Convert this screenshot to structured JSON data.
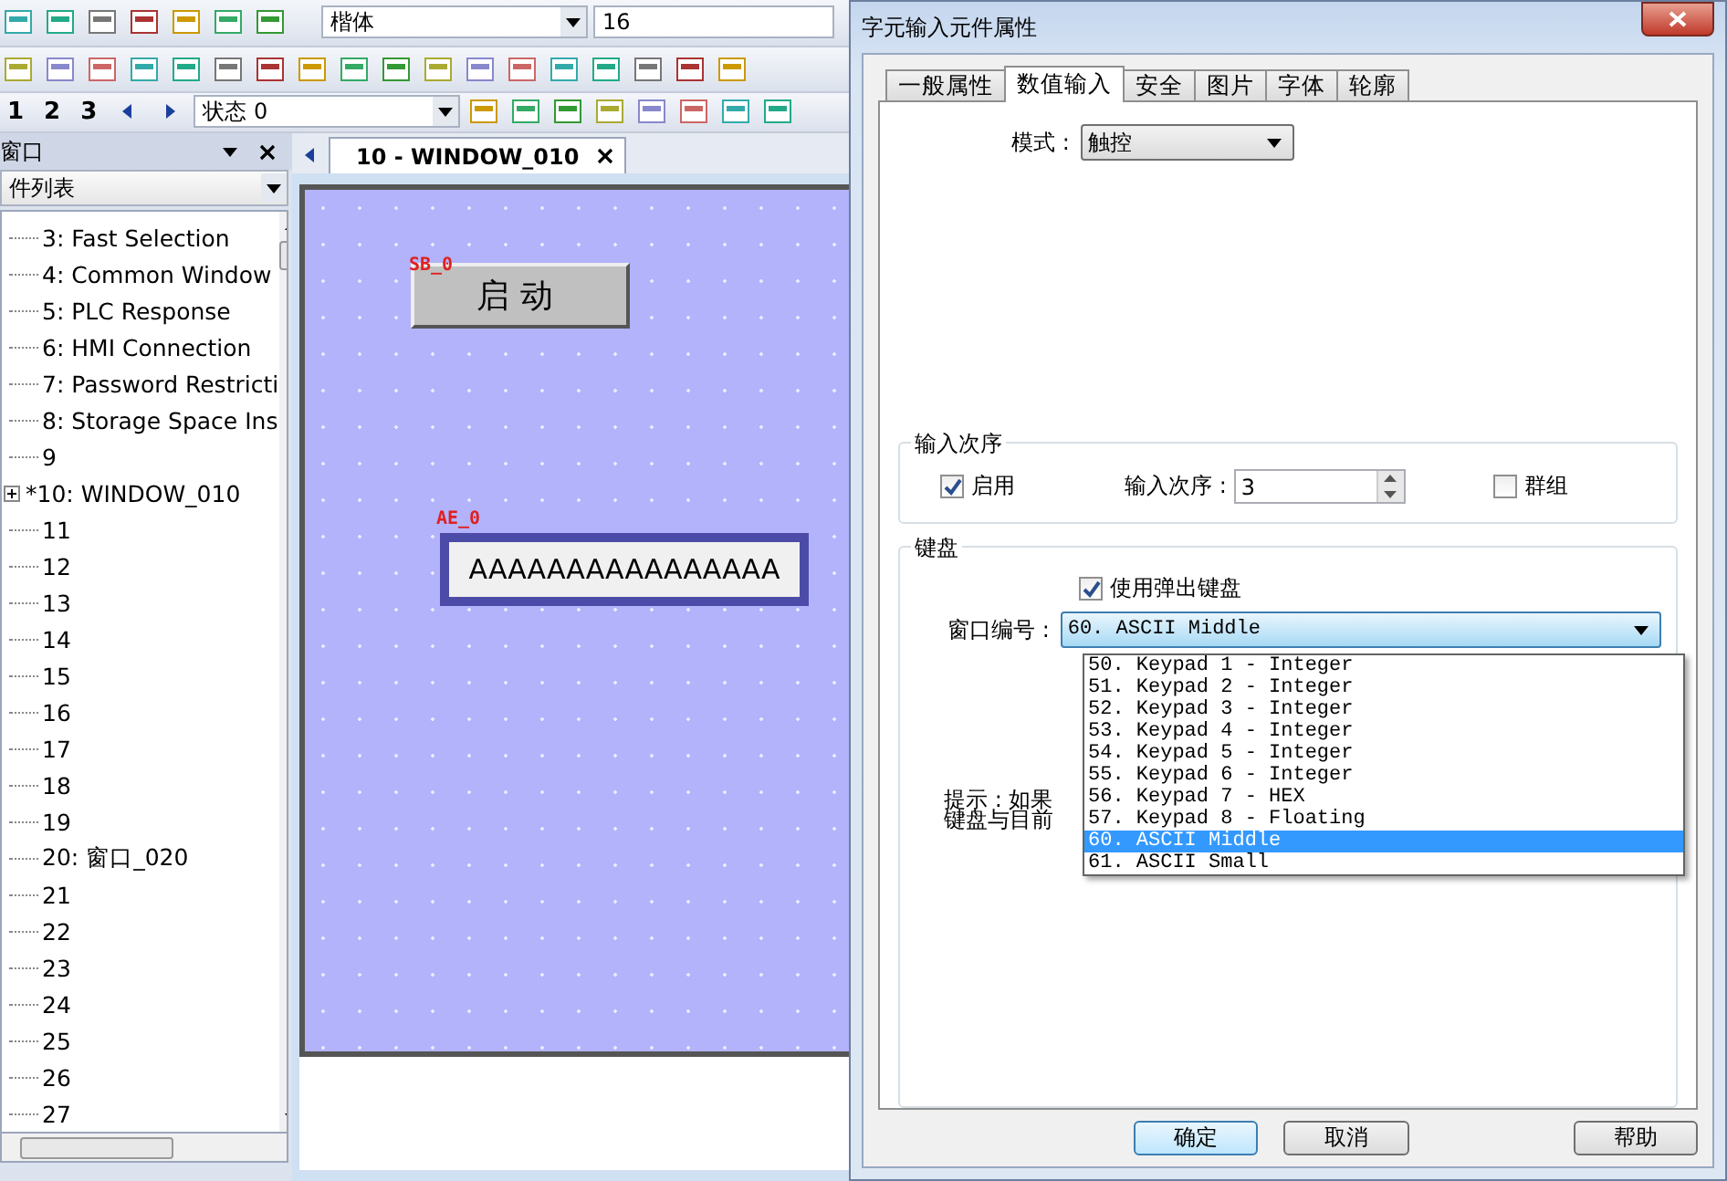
{
  "toolbar": {
    "font": "楷体",
    "font_size": "16",
    "pages": [
      "1",
      "2",
      "3"
    ],
    "state": "状态 0"
  },
  "panel": {
    "title": "窗口",
    "selector": "件列表",
    "tree": [
      {
        "label": "3: Fast Selection",
        "kind": "leaf"
      },
      {
        "label": "4: Common Window",
        "kind": "leaf"
      },
      {
        "label": "5: PLC Response",
        "kind": "leaf"
      },
      {
        "label": "6: HMI Connection",
        "kind": "leaf"
      },
      {
        "label": "7: Password Restricti",
        "kind": "leaf"
      },
      {
        "label": "8: Storage Space Ins",
        "kind": "leaf"
      },
      {
        "label": "9",
        "kind": "leaf"
      },
      {
        "label": "*10: WINDOW_010",
        "kind": "node"
      },
      {
        "label": "11",
        "kind": "leaf"
      },
      {
        "label": "12",
        "kind": "leaf"
      },
      {
        "label": "13",
        "kind": "leaf"
      },
      {
        "label": "14",
        "kind": "leaf"
      },
      {
        "label": "15",
        "kind": "leaf"
      },
      {
        "label": "16",
        "kind": "leaf"
      },
      {
        "label": "17",
        "kind": "leaf"
      },
      {
        "label": "18",
        "kind": "leaf"
      },
      {
        "label": "19",
        "kind": "leaf"
      },
      {
        "label": "20: 窗口_020",
        "kind": "leaf"
      },
      {
        "label": "21",
        "kind": "leaf"
      },
      {
        "label": "22",
        "kind": "leaf"
      },
      {
        "label": "23",
        "kind": "leaf"
      },
      {
        "label": "24",
        "kind": "leaf"
      },
      {
        "label": "25",
        "kind": "leaf"
      },
      {
        "label": "26",
        "kind": "leaf"
      },
      {
        "label": "27",
        "kind": "leaf"
      }
    ]
  },
  "editor": {
    "tab": "10 - WINDOW_010",
    "objects": [
      {
        "kind": "button",
        "tag": "SB_0",
        "text": "启动"
      },
      {
        "kind": "ascii_input",
        "tag": "AE_0",
        "text": "AAAAAAAAAAAAAAAA"
      }
    ]
  },
  "dialog": {
    "title": "字元输入元件属性",
    "tabs": [
      {
        "label": "一般属性",
        "selected": false
      },
      {
        "label": "数值输入",
        "selected": true
      },
      {
        "label": "安全",
        "selected": false
      },
      {
        "label": "图片",
        "selected": false
      },
      {
        "label": "字体",
        "selected": false
      },
      {
        "label": "轮廓",
        "selected": false
      }
    ],
    "mode": {
      "label": "模式 :",
      "value": "触控"
    },
    "input_order": {
      "title": "输入次序",
      "enable": {
        "label": "启用",
        "checked": true
      },
      "order_label": "输入次序 :",
      "order_value": "3",
      "group": {
        "label": "群组",
        "checked": false
      }
    },
    "keyboard": {
      "title": "键盘",
      "popup": {
        "label": "使用弹出键盘",
        "checked": true
      },
      "window_label": "窗口编号 :",
      "window_value": "60. ASCII Middle",
      "options": [
        {
          "label": "50. Keypad 1 - Integer",
          "selected": false
        },
        {
          "label": "51. Keypad 2 - Integer",
          "selected": false
        },
        {
          "label": "52. Keypad 3 - Integer",
          "selected": false
        },
        {
          "label": "53. Keypad 4 - Integer",
          "selected": false
        },
        {
          "label": "54. Keypad 5 - Integer",
          "selected": false
        },
        {
          "label": "55. Keypad 6 - Integer",
          "selected": false
        },
        {
          "label": "56. Keypad 7 - HEX",
          "selected": false
        },
        {
          "label": "57. Keypad 8 - Floating",
          "selected": false
        },
        {
          "label": "60. ASCII Middle",
          "selected": true
        },
        {
          "label": "61. ASCII Small",
          "selected": false
        }
      ],
      "hint": [
        "提示 : 如果",
        "键盘与目前"
      ]
    },
    "buttons": [
      "确定",
      "取消",
      "帮助"
    ]
  }
}
